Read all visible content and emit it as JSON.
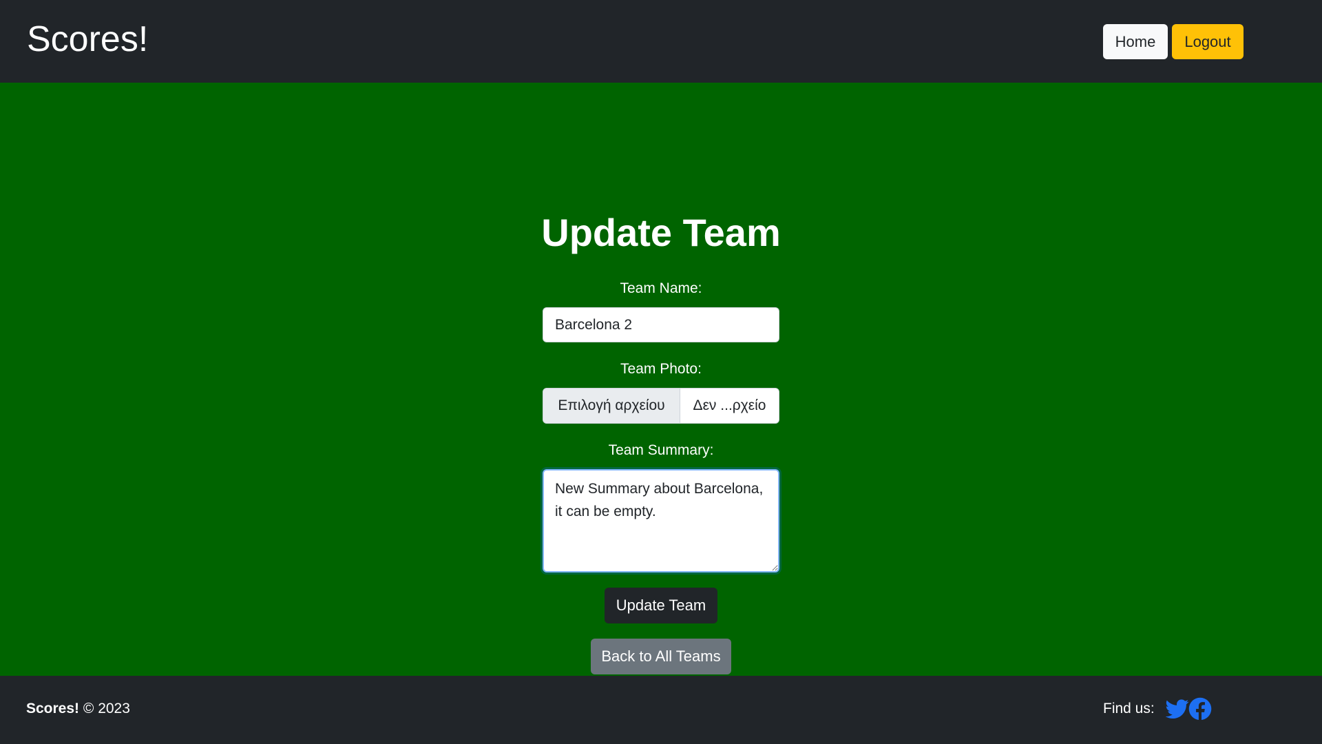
{
  "navbar": {
    "brand": "Scores!",
    "home_label": "Home",
    "logout_label": "Logout"
  },
  "form": {
    "title": "Update Team",
    "team_name_label": "Team Name:",
    "team_name_value": "Barcelona 2",
    "team_photo_label": "Team Photo:",
    "file_choose_label": "Επιλογή αρχείου",
    "file_status": "Δεν ...ρχείο",
    "team_summary_label": "Team Summary:",
    "team_summary_value": "New Summary about Barcelona, it can be empty.",
    "update_button": "Update Team",
    "back_button": "Back to All Teams"
  },
  "footer": {
    "brand": "Scores!",
    "copyright": "© 2023",
    "find_us": "Find us:",
    "icons": [
      "twitter-icon",
      "facebook-icon"
    ]
  },
  "colors": {
    "navbar_bg": "#212529",
    "page_bg": "#006400",
    "logout_bg": "#ffc107",
    "back_bg": "#6c757d",
    "social_blue": "#1d6ff2"
  }
}
